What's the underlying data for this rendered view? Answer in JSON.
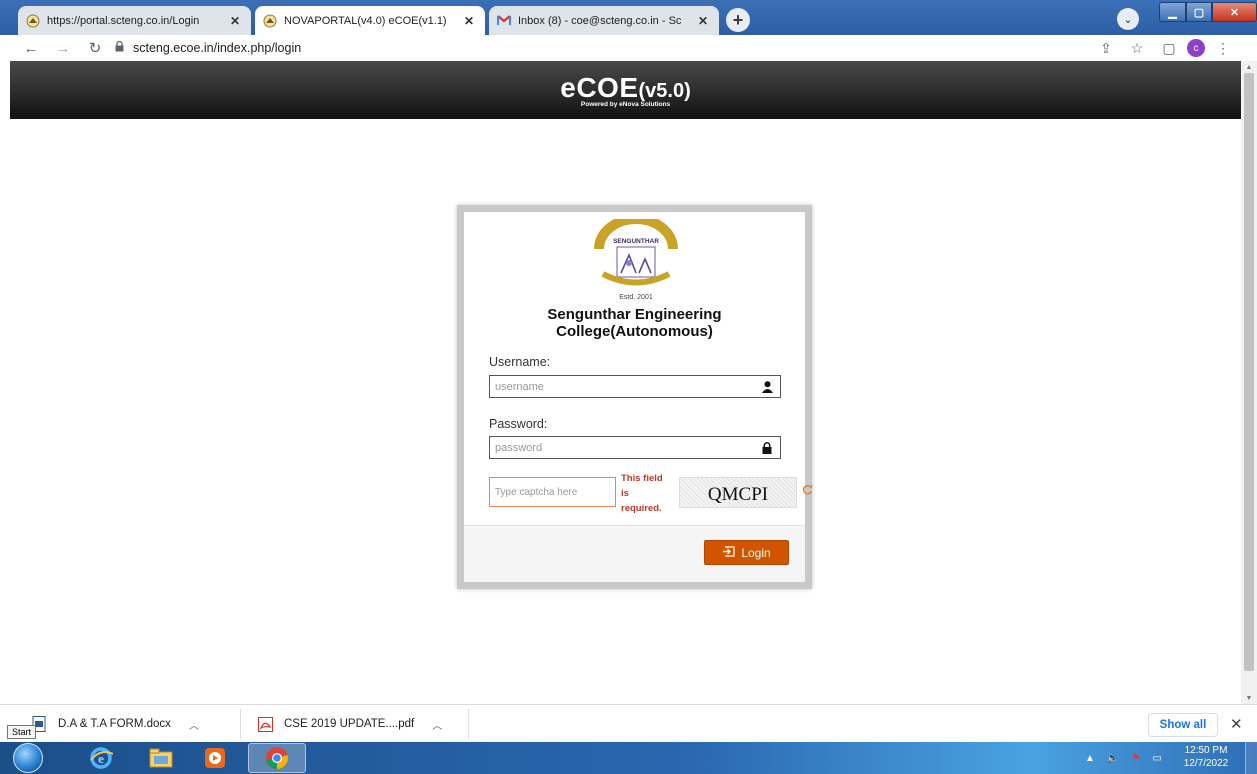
{
  "browser": {
    "tabs": [
      {
        "title": "https://portal.scteng.co.in/Login",
        "close": "✕",
        "active": false
      },
      {
        "title": "NOVAPORTAL(v4.0) eCOE(v1.1)",
        "close": "✕",
        "active": true
      },
      {
        "title": "Inbox (8) - coe@scteng.co.in - Sc",
        "close": "✕",
        "active": false
      }
    ],
    "new_tab": "+",
    "address": "scteng.ecoe.in/index.php/login",
    "profile_initial": "c"
  },
  "header": {
    "title_main": "eCOE",
    "title_version": "(v5.0)",
    "subtitle": "Powered by eNova Solutions"
  },
  "login": {
    "logo": {
      "arc_text": "SENGUNTHAR",
      "estd": "Estd. 2001"
    },
    "college_line1": "Sengunthar Engineering",
    "college_line2": "College(Autonomous)",
    "username_label": "Username:",
    "username_placeholder": "username",
    "password_label": "Password:",
    "password_placeholder": "password",
    "captcha_placeholder": "Type captcha here",
    "captcha_error": "This field is required.",
    "captcha_text": "QMCPI",
    "login_button": "Login",
    "colors": {
      "button": "#d35400",
      "error": "#c0392b"
    }
  },
  "downloads": {
    "items": [
      {
        "name": "D.A & T.A FORM.docx",
        "icon": "word-doc-icon"
      },
      {
        "name": "CSE 2019 UPDATE....pdf",
        "icon": "pdf-icon"
      }
    ],
    "show_all": "Show all",
    "start_tooltip": "Start"
  },
  "taskbar": {
    "time": "12:50 PM",
    "date": "12/7/2022"
  }
}
